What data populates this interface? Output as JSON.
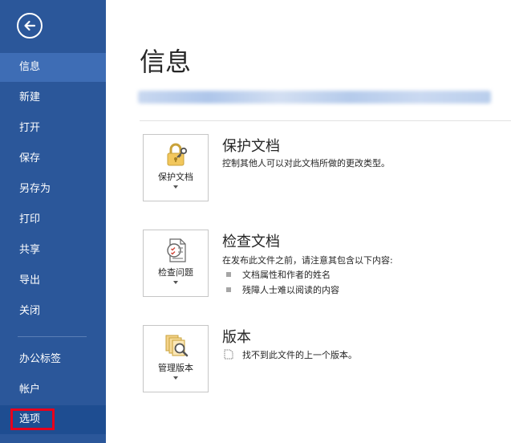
{
  "sidebar": {
    "back_icon": "arrow-left-circle-icon",
    "items": [
      {
        "label": "信息"
      },
      {
        "label": "新建"
      },
      {
        "label": "打开"
      },
      {
        "label": "保存"
      },
      {
        "label": "另存为"
      },
      {
        "label": "打印"
      },
      {
        "label": "共享"
      },
      {
        "label": "导出"
      },
      {
        "label": "关闭"
      },
      {
        "label": "办公标签"
      },
      {
        "label": "帐户"
      },
      {
        "label": "选项"
      }
    ],
    "active_item": "信息",
    "highlight_color": "#e8001c",
    "background_color": "#2b579a"
  },
  "main": {
    "title": "信息",
    "sections": [
      {
        "tile_label": "保护文档",
        "tile_icon": "lock-key-icon",
        "title": "保护文档",
        "description": "控制其他人可以对此文档所做的更改类型。"
      },
      {
        "tile_label": "检查问题",
        "tile_icon": "inspect-document-icon",
        "title": "检查文档",
        "description": "在发布此文件之前，请注意其包含以下内容:",
        "bullets": [
          "文档属性和作者的姓名",
          "残障人士难以阅读的内容"
        ]
      },
      {
        "tile_label": "管理版本",
        "tile_icon": "manage-versions-icon",
        "title": "版本",
        "description": "找不到此文件的上一个版本。"
      }
    ]
  }
}
